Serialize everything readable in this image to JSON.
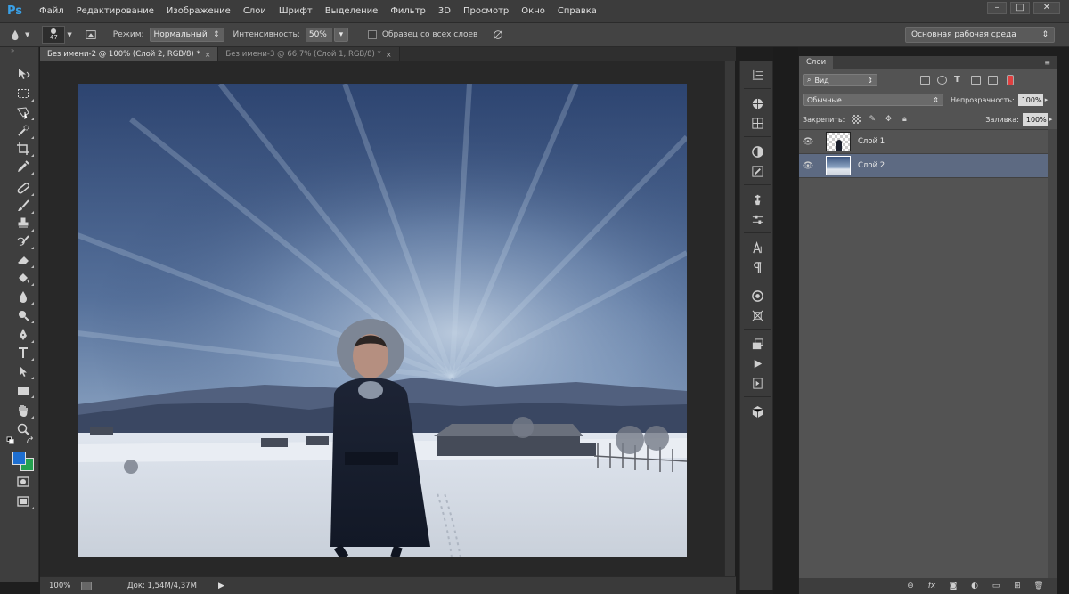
{
  "app": {
    "logo": "Ps"
  },
  "menu": [
    "Файл",
    "Редактирование",
    "Изображение",
    "Слои",
    "Шрифт",
    "Выделение",
    "Фильтр",
    "3D",
    "Просмотр",
    "Окно",
    "Справка"
  ],
  "window_controls": {
    "minimize": "–",
    "maximize": "□",
    "close": "✕"
  },
  "options": {
    "brush_size": "47",
    "mode_label": "Режим:",
    "mode_value": "Нормальный",
    "intensity_label": "Интенсивность:",
    "intensity_value": "50%",
    "sample_all_label": "Образец со всех слоев",
    "workspace_value": "Основная рабочая среда"
  },
  "tabs": [
    {
      "label": "Без имени-2 @ 100% (Слой 2, RGB/8) *",
      "active": true
    },
    {
      "label": "Без имени-3 @ 66,7% (Слой 1, RGB/8) *",
      "active": false
    }
  ],
  "status": {
    "zoom": "100%",
    "doc": "Док: 1,54M/4,37M",
    "arrow": "▶"
  },
  "layers_panel": {
    "title": "Слои",
    "filter_value": "Вид",
    "blend_value": "Обычные",
    "opacity_label": "Непрозрачность:",
    "opacity_value": "100%",
    "lock_label": "Закрепить:",
    "fill_label": "Заливка:",
    "fill_value": "100%",
    "layers": [
      {
        "name": "Слой 1",
        "selected": false
      },
      {
        "name": "Слой 2",
        "selected": true
      }
    ],
    "footer_icons": [
      "link-icon",
      "fx-icon",
      "mask-icon",
      "adjustment-icon",
      "group-icon",
      "new-layer-icon",
      "trash-icon"
    ],
    "footer_fx": "fx"
  },
  "colors": {
    "foreground": "#1e6fd1",
    "background": "#24a14f",
    "selected_layer": "#5d6a82",
    "accent_logo": "#3aa0e6"
  }
}
